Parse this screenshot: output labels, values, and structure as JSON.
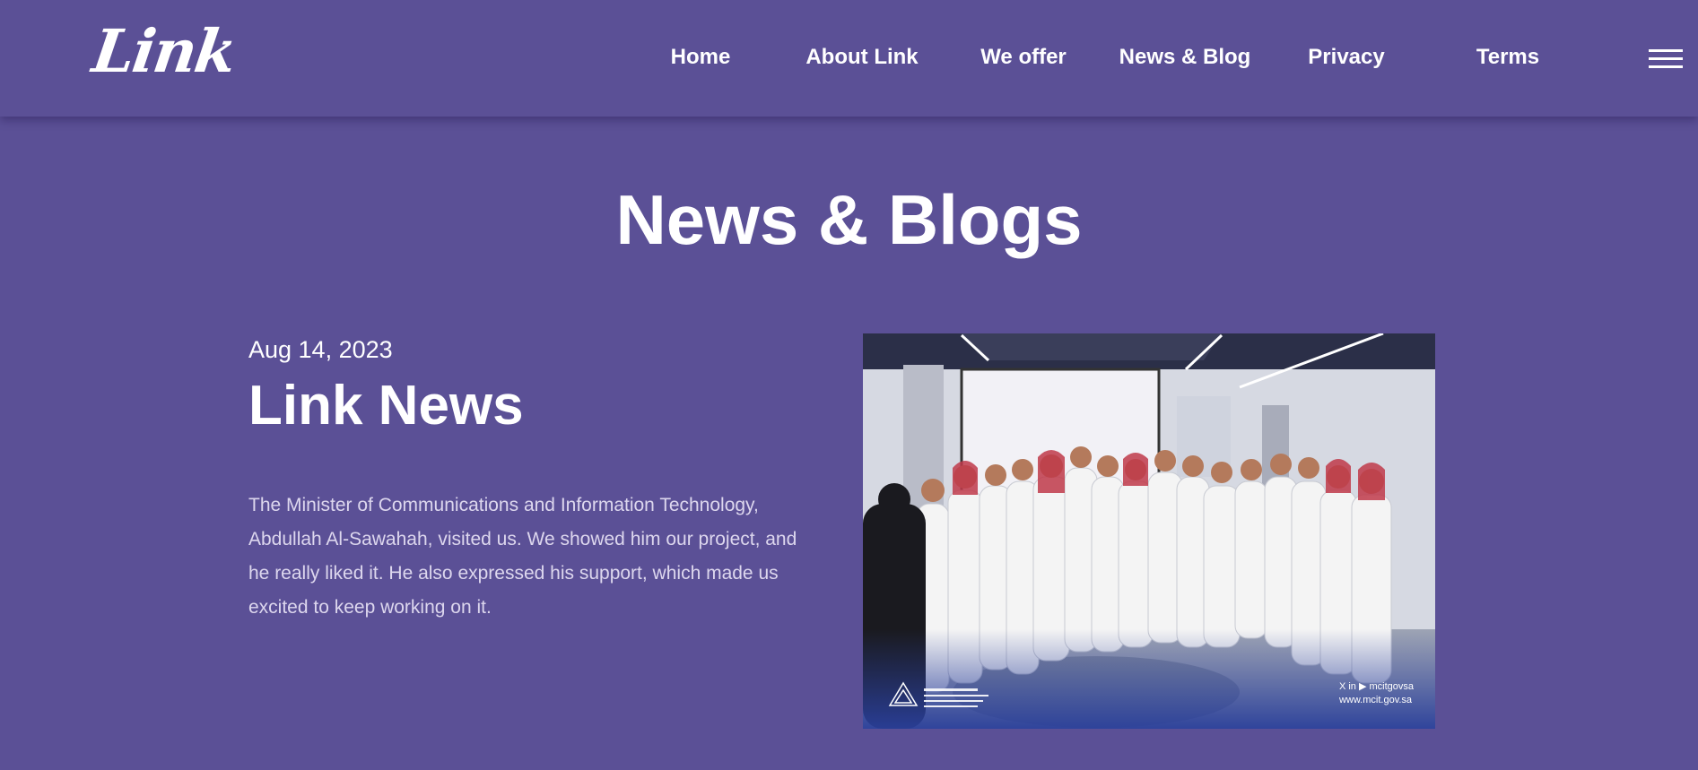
{
  "header": {
    "logo_text": "Link",
    "nav": [
      {
        "label": "Home"
      },
      {
        "label": "About Link"
      },
      {
        "label": "We offer"
      },
      {
        "label": "News & Blog"
      },
      {
        "label": "Privacy"
      },
      {
        "label": "Terms"
      }
    ],
    "menu_icon": "hamburger-icon"
  },
  "page": {
    "title": "News & Blogs"
  },
  "post": {
    "date": "Aug 14, 2023",
    "title": "Link News",
    "body": "The Minister of Communications and Information Technology, Abdullah Al-Sawahah, visited us. We showed him our project, and he really liked it. He also expressed his support, which made us excited to keep working on it.",
    "image": {
      "social_line": "X in ▶ mcitgovsa",
      "website": "www.mcit.gov.sa"
    }
  },
  "colors": {
    "background": "#5b5096",
    "text": "#ffffff",
    "body_text": "#ddd7ee"
  }
}
